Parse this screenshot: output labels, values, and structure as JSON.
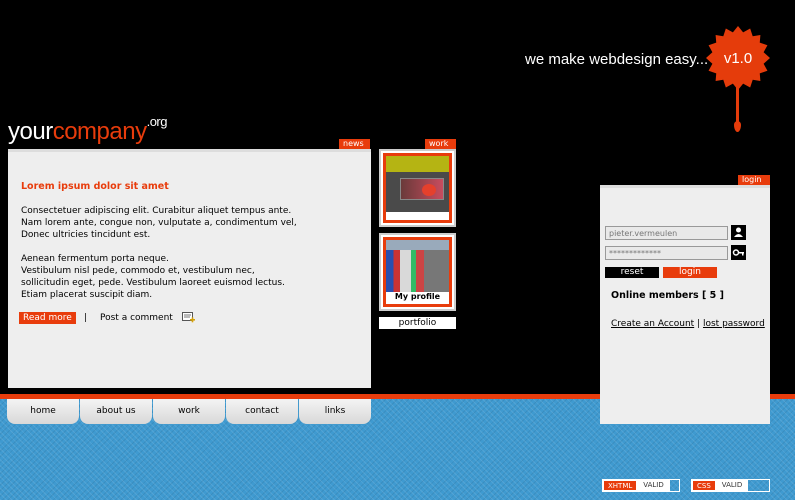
{
  "header": {
    "tagline": "we make webdesign easy...",
    "version_badge": "v1.0",
    "logo": {
      "part1": "your",
      "part2": "company",
      "tld": ".org"
    }
  },
  "tabs": {
    "news": "news",
    "work": "work",
    "login": "login"
  },
  "news": {
    "title": "Lorem ipsum dolor sit amet",
    "para1": [
      "Consectetuer adipiscing elit. Curabitur aliquet tempus ante.",
      "Nam lorem ante, congue non, vulputate a, condimentum vel,",
      "Donec ultricies tincidunt est."
    ],
    "para2": [
      "Aenean fermentum porta neque.",
      "Vestibulum nisl pede, commodo et, vestibulum nec,",
      "sollicitudin eget, pede. Vestibulum laoreet euismod lectus.",
      "Etiam placerat suscipit diam."
    ],
    "read_more": "Read more",
    "separator": "|",
    "post_comment": "Post a comment"
  },
  "work": {
    "thumb2_caption": "My profile",
    "portfolio_label": "portfolio"
  },
  "login": {
    "username_value": "pieter.vermeulen",
    "password_value": "*************",
    "reset_label": "reset",
    "login_label": "login",
    "online_members": "Online members [ 5 ]",
    "create_account": "Create an Account",
    "links_separator": "|",
    "lost_password": "lost password"
  },
  "nav": [
    "home",
    "about us",
    "work",
    "contact",
    "links"
  ],
  "footer": {
    "xhtml": {
      "a": "XHTML",
      "b": "VALID"
    },
    "css": {
      "a": "CSS",
      "b": "VALID"
    }
  },
  "colors": {
    "accent": "#e83c0c",
    "background": "#000000",
    "bottom": "#3f9ad0",
    "panel": "#eeeeee"
  }
}
